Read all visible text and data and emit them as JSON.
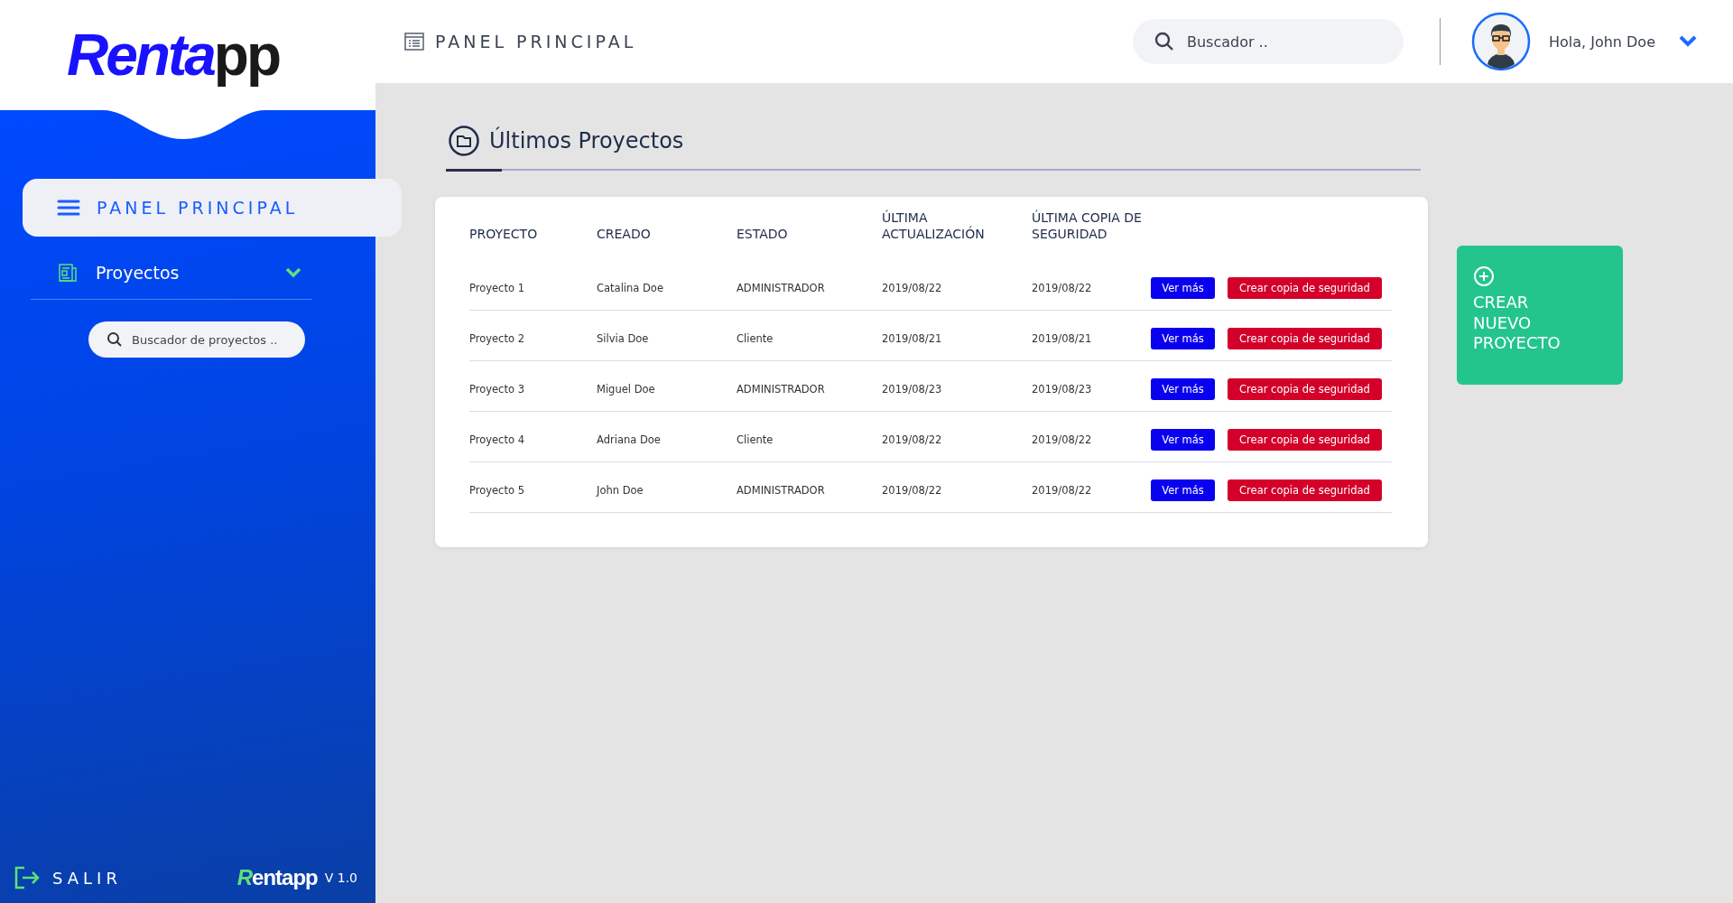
{
  "logo": {
    "primary": "Renta",
    "secondary": "pp"
  },
  "header": {
    "title": "PANEL PRINCIPAL",
    "search": {
      "placeholder": "Buscador .."
    },
    "greeting": "Hola, John Doe"
  },
  "sidebar": {
    "items": [
      {
        "label": "PANEL PRINCIPAL",
        "kind": "main",
        "selected": true
      },
      {
        "label": "Proyectos",
        "kind": "group",
        "selected": false
      }
    ],
    "search": {
      "placeholder": "Buscador de proyectos .."
    },
    "logout": "SALIR",
    "footer_logo": {
      "primary": "R",
      "secondary": "entapp"
    },
    "version": "V 1.0"
  },
  "section": {
    "title": "Últimos Proyectos"
  },
  "table": {
    "columns": [
      "PROYECTO",
      "CREADO",
      "ESTADO",
      "ÚLTIMA ACTUALIZACIÓN",
      "ÚLTIMA COPIA DE SEGURIDAD"
    ],
    "rows": [
      {
        "cells": [
          "Proyecto 1",
          "Catalina Doe",
          "ADMINISTRADOR",
          "2019/08/22",
          "2019/08/22"
        ],
        "view": "Ver más",
        "backup": "Crear copia de seguridad"
      },
      {
        "cells": [
          "Proyecto 2",
          "Silvia Doe",
          "Cliente",
          "2019/08/21",
          "2019/08/21"
        ],
        "view": "Ver más",
        "backup": "Crear copia de seguridad"
      },
      {
        "cells": [
          "Proyecto 3",
          "Miguel Doe",
          "ADMINISTRADOR",
          "2019/08/23",
          "2019/08/23"
        ],
        "view": "Ver más",
        "backup": "Crear copia de seguridad"
      },
      {
        "cells": [
          "Proyecto 4",
          "Adriana Doe",
          "Cliente",
          "2019/08/22",
          "2019/08/22"
        ],
        "view": "Ver más",
        "backup": "Crear copia de seguridad"
      },
      {
        "cells": [
          "Proyecto 5",
          "John Doe",
          "ADMINISTRADOR",
          "2019/08/22",
          "2019/08/22"
        ],
        "view": "Ver más",
        "backup": "Crear copia de seguridad"
      }
    ]
  },
  "create_button": {
    "label": "CREAR NUEVO PROYECTO"
  }
}
